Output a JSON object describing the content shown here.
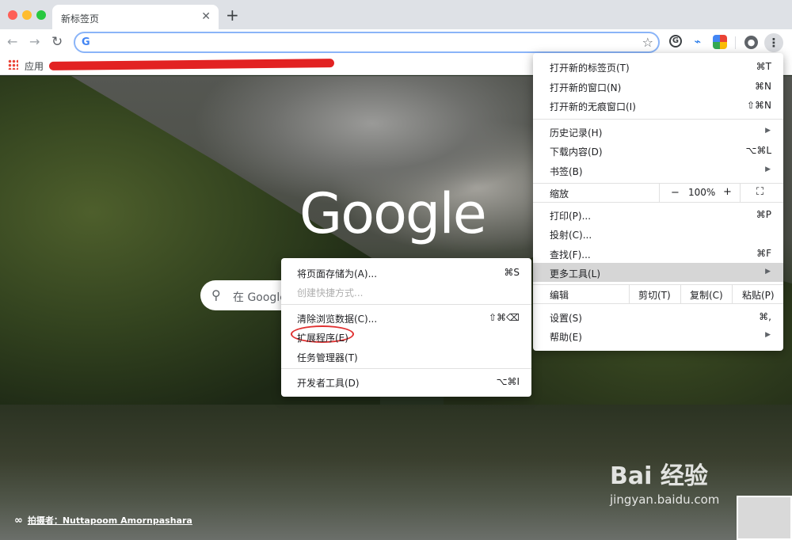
{
  "tab": {
    "title": "新标签页",
    "close": "✕",
    "new_tab": "+"
  },
  "toolbar": {
    "back": "←",
    "forward": "→",
    "reload": "↻",
    "omnibox_icon": "G",
    "omnibox_value": "",
    "star": "☆",
    "extensions": [
      "G",
      "🧹",
      "⬛"
    ],
    "profile": "●",
    "menu": "⋮"
  },
  "bookmarks": {
    "apps_label": "应用"
  },
  "ntp": {
    "logo": "Google",
    "search_icon": "⚲",
    "search_placeholder": "在 Google",
    "photo_credit_icon": "🔗",
    "photo_credit": "拍摄者：Nuttapoom Amornpashara"
  },
  "watermark": {
    "big": "Bai 经验",
    "small": "jingyan.baidu.com"
  },
  "menu": {
    "items": [
      {
        "label": "打开新的标签页(T)",
        "shortcut": "⌘T"
      },
      {
        "label": "打开新的窗口(N)",
        "shortcut": "⌘N"
      },
      {
        "label": "打开新的无痕窗口(I)",
        "shortcut": "⇧⌘N"
      },
      {
        "label": "历史记录(H)",
        "arrow": "▶"
      },
      {
        "label": "下载内容(D)",
        "shortcut": "⌥⌘L"
      },
      {
        "label": "书签(B)",
        "arrow": "▶"
      },
      {
        "label": "打印(P)...",
        "shortcut": "⌘P"
      },
      {
        "label": "投射(C)..."
      },
      {
        "label": "查找(F)...",
        "shortcut": "⌘F"
      },
      {
        "label": "更多工具(L)",
        "arrow": "▶"
      },
      {
        "label": "设置(S)",
        "shortcut": "⌘,"
      },
      {
        "label": "帮助(E)",
        "arrow": "▶"
      }
    ],
    "zoom": {
      "label": "缩放",
      "minus": "−",
      "value": "100%",
      "plus": "+",
      "fullscreen": "⛶"
    },
    "edit": {
      "label": "编辑",
      "cut": "剪切(T)",
      "copy": "复制(C)",
      "paste": "粘贴(P)"
    }
  },
  "submenu": {
    "items": [
      {
        "label": "将页面存储为(A)...",
        "shortcut": "⌘S"
      },
      {
        "label": "创建快捷方式...",
        "disabled": true
      },
      {
        "label": "清除浏览数据(C)...",
        "shortcut": "⇧⌘⌫"
      },
      {
        "label": "扩展程序(E)"
      },
      {
        "label": "任务管理器(T)"
      },
      {
        "label": "开发者工具(D)",
        "shortcut": "⌥⌘I"
      }
    ]
  },
  "colors": {
    "accent": "#8ab4f8",
    "highlight": "#d6d6d6",
    "annotation": "#e03030"
  }
}
